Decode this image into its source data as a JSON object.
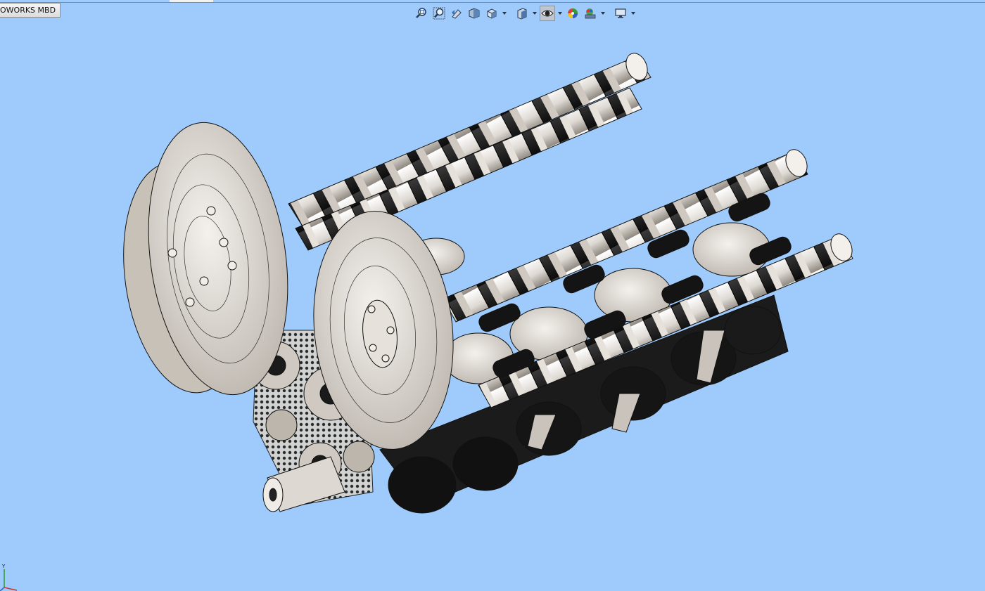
{
  "tab": {
    "label": "OWORKS MBD"
  },
  "toolbar": {
    "buttons": [
      {
        "name": "zoom-to-fit",
        "icon": "zoom-to-fit-icon"
      },
      {
        "name": "zoom-to-area",
        "icon": "zoom-area-icon"
      },
      {
        "name": "previous-view",
        "icon": "previous-view-icon"
      },
      {
        "name": "section-view",
        "icon": "section-view-icon"
      },
      {
        "name": "view-orientation",
        "icon": "view-orientation-icon",
        "dropdown": true
      },
      {
        "name": "display-style",
        "icon": "display-style-icon",
        "dropdown": true
      },
      {
        "name": "hide-show-items",
        "icon": "eye-icon",
        "dropdown": true,
        "active": true
      },
      {
        "name": "edit-appearance",
        "icon": "appearance-icon"
      },
      {
        "name": "apply-scene",
        "icon": "scene-icon",
        "dropdown": true
      },
      {
        "name": "view-settings",
        "icon": "monitor-icon",
        "dropdown": true
      }
    ]
  },
  "viewport": {
    "background": "#9ecbfb",
    "model": "engine-assembly"
  },
  "triad": {
    "axis_label": "Y"
  }
}
